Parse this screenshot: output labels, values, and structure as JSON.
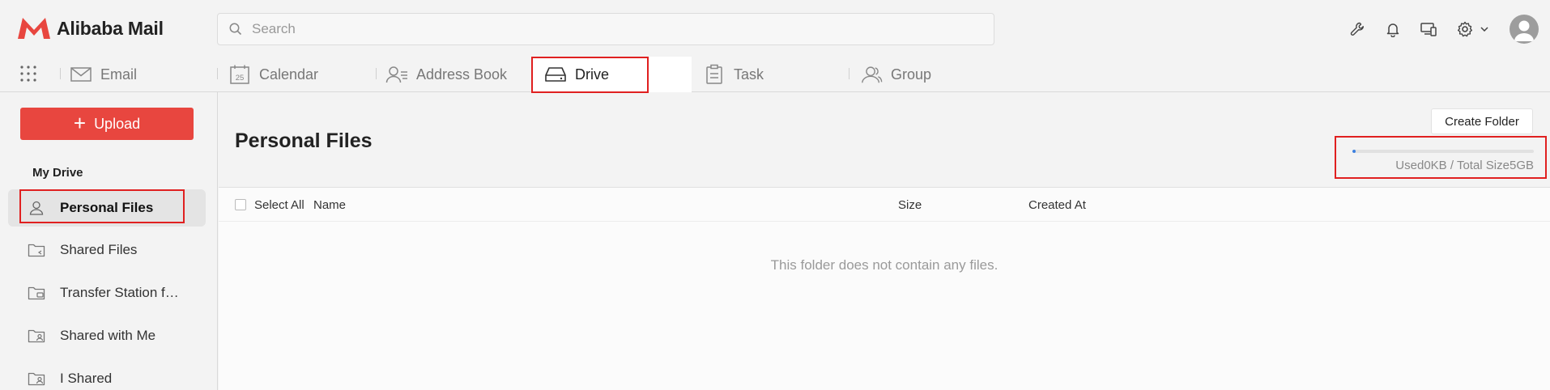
{
  "app": {
    "name": "Alibaba Mail",
    "brand_color": "#e8463f"
  },
  "search": {
    "placeholder": "Search"
  },
  "header_icons": [
    "wrench-icon",
    "bell-icon",
    "devices-icon",
    "gear-icon",
    "chevron-down-icon"
  ],
  "nav": {
    "tabs": [
      {
        "label": "Email",
        "icon": "mail-icon",
        "active": false
      },
      {
        "label": "Calendar",
        "icon": "calendar-icon",
        "active": false,
        "icon_text": "25"
      },
      {
        "label": "Address Book",
        "icon": "contacts-icon",
        "active": false
      },
      {
        "label": "Drive",
        "icon": "drive-icon",
        "active": true
      },
      {
        "label": "Task",
        "icon": "clipboard-icon",
        "active": false
      },
      {
        "label": "Group",
        "icon": "group-icon",
        "active": false
      }
    ]
  },
  "sidebar": {
    "upload_label": "Upload",
    "section_title": "My Drive",
    "items": [
      {
        "label": "Personal Files",
        "icon": "user-icon",
        "active": true
      },
      {
        "label": "Shared Files",
        "icon": "shared-folder-icon",
        "active": false
      },
      {
        "label": "Transfer Station f…",
        "icon": "transfer-folder-icon",
        "active": false
      },
      {
        "label": "Shared with Me",
        "icon": "folder-user-icon",
        "active": false
      },
      {
        "label": "I Shared",
        "icon": "folder-share-icon",
        "active": false
      }
    ]
  },
  "main": {
    "title": "Personal Files",
    "create_folder_label": "Create Folder",
    "usage": {
      "used_label": "Used",
      "used": "0KB",
      "separator": "/",
      "total_label": "Total Size",
      "total": "5GB",
      "fraction": 0.0
    },
    "table": {
      "select_all": "Select All",
      "columns": [
        "Name",
        "Size",
        "Created At"
      ]
    },
    "empty_message": "This folder does not contain any files."
  },
  "highlight_color": "#e02020"
}
